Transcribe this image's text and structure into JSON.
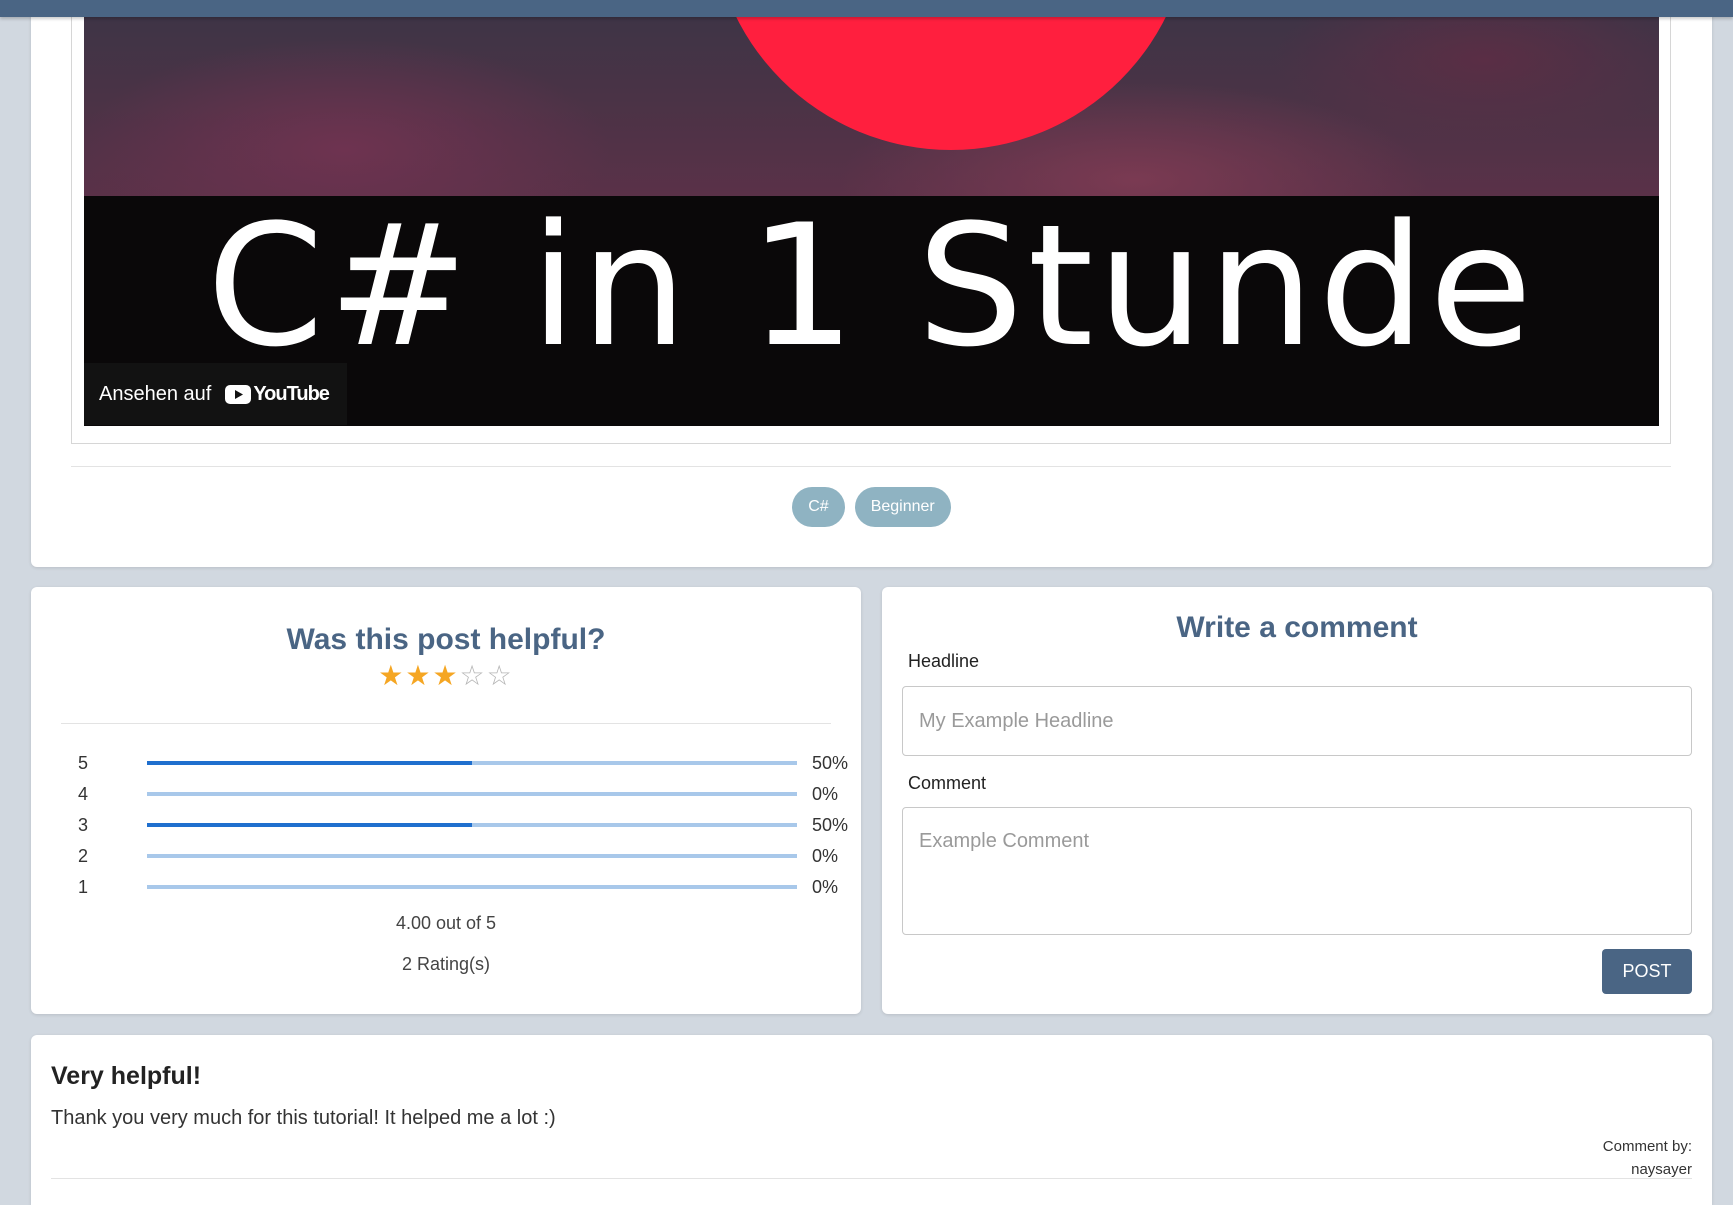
{
  "video": {
    "title_text": "C# in 1 Stunde",
    "watch_on": "Ansehen auf",
    "platform": "YouTube"
  },
  "tags": [
    "C#",
    "Beginner"
  ],
  "rating": {
    "title": "Was this post helpful?",
    "stars_filled": 3,
    "stars_total": 5,
    "rows": [
      {
        "label": "5",
        "percent_text": "50%",
        "fraction": 0.5
      },
      {
        "label": "4",
        "percent_text": "0%",
        "fraction": 0
      },
      {
        "label": "3",
        "percent_text": "50%",
        "fraction": 0.5
      },
      {
        "label": "2",
        "percent_text": "0%",
        "fraction": 0
      },
      {
        "label": "1",
        "percent_text": "0%",
        "fraction": 0
      }
    ],
    "average_text": "4.00 out of 5",
    "count_text": "2 Rating(s)"
  },
  "comment_form": {
    "title": "Write a comment",
    "headline_label": "Headline",
    "headline_placeholder": "My Example Headline",
    "comment_label": "Comment",
    "comment_placeholder": "Example Comment",
    "post_label": "POST"
  },
  "review": {
    "headline": "Very helpful!",
    "body": "Thank you very much for this tutorial! It helped me a lot :)",
    "by_label": "Comment by:",
    "author": "naysayer"
  },
  "colors": {
    "accent": "#4a6584",
    "tag": "#8fb3c2",
    "bar_fill": "#1f6fce",
    "bar_track": "#a8c8ea",
    "star": "#f5a623"
  }
}
